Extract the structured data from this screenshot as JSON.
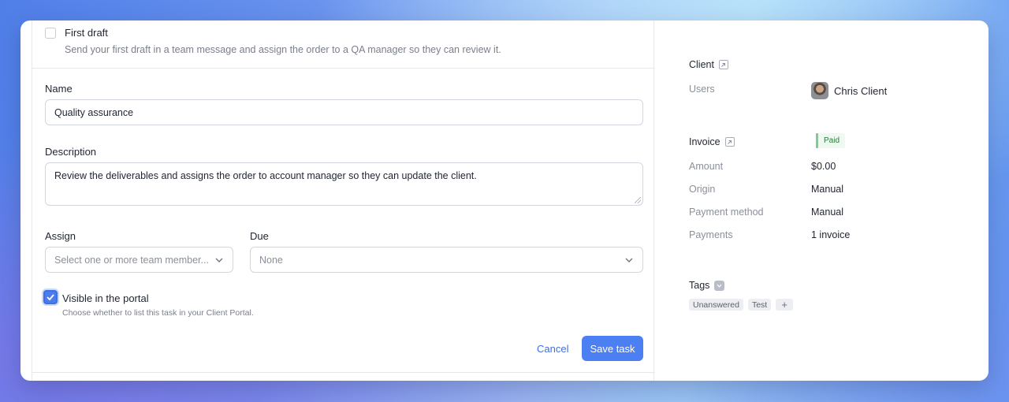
{
  "task": {
    "draft_title": "First draft",
    "draft_description": "Send your first draft in a team message and assign the order to a QA manager so they can review it.",
    "name_label": "Name",
    "name_value": "Quality assurance",
    "description_label": "Description",
    "description_value": "Review the deliverables and assigns the order to account manager so they can update the client.",
    "assign_label": "Assign",
    "assign_placeholder": "Select one or more team member...",
    "due_label": "Due",
    "due_value": "None",
    "visible_label": "Visible in the portal",
    "visible_help": "Choose whether to list this task in your Client Portal.",
    "visible_checked": true,
    "cancel_label": "Cancel",
    "save_label": "Save task"
  },
  "sidebar": {
    "client_heading": "Client",
    "users_key": "Users",
    "user_name": "Chris Client",
    "invoice_heading": "Invoice",
    "invoice_status": "Paid",
    "amount_key": "Amount",
    "amount_value": "$0.00",
    "origin_key": "Origin",
    "origin_value": "Manual",
    "payment_method_key": "Payment method",
    "payment_method_value": "Manual",
    "payments_key": "Payments",
    "payments_value": "1 invoice",
    "tags_heading": "Tags",
    "tags": [
      "Unanswered",
      "Test"
    ],
    "add_tag_symbol": "+"
  },
  "colors": {
    "accent": "#4c7ff2",
    "paid_green": "#7ccf8a"
  }
}
